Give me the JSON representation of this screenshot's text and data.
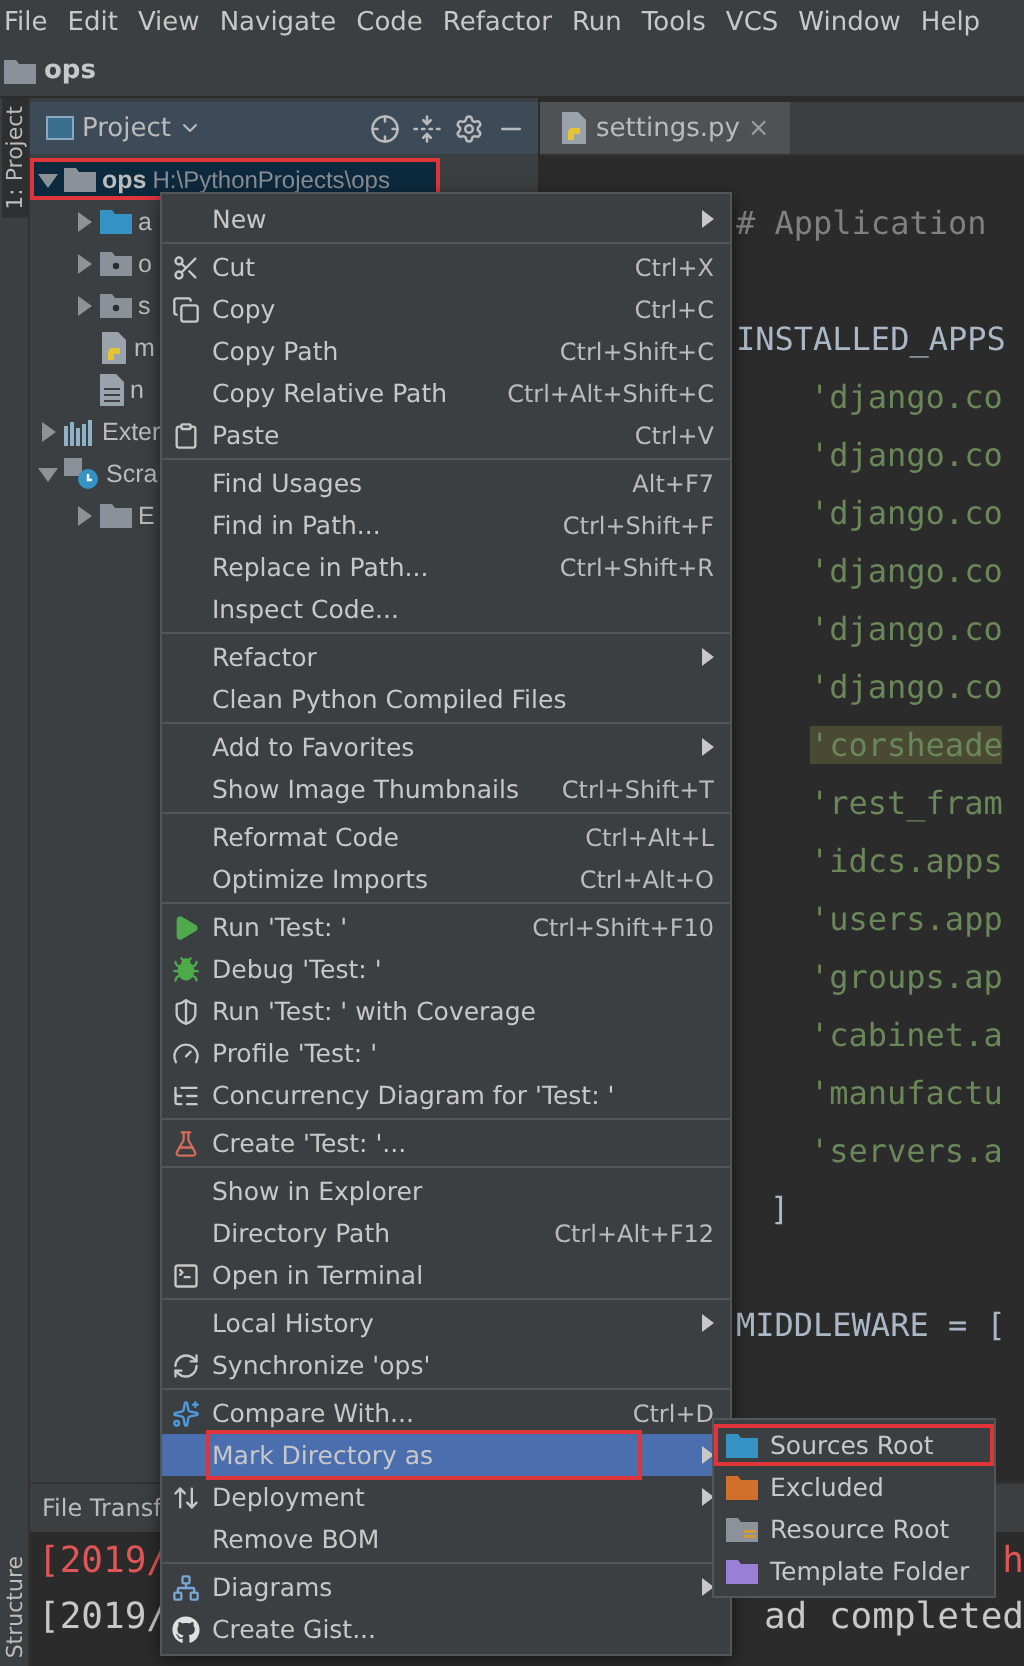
{
  "menu_bar": [
    "File",
    "Edit",
    "View",
    "Navigate",
    "Code",
    "Refactor",
    "Run",
    "Tools",
    "VCS",
    "Window",
    "Help"
  ],
  "nav_bar": {
    "crumb": "ops"
  },
  "side_strip": {
    "top": "1: Project",
    "bottom": "Structure"
  },
  "project_panel": {
    "title": "Project",
    "tree": [
      {
        "label": "ops",
        "path": "H:\\PythonProjects\\ops",
        "kind": "folder",
        "expanded": true,
        "selected": true,
        "annotated": true,
        "children": [
          {
            "label": "a",
            "kind": "source-folder",
            "expanded": false,
            "selected": false
          },
          {
            "label": "o",
            "kind": "package",
            "expanded": false,
            "selected": false
          },
          {
            "label": "s",
            "kind": "package",
            "expanded": false,
            "selected": false
          },
          {
            "label": "m",
            "kind": "python-file",
            "selected": false
          },
          {
            "label": "n",
            "kind": "text-file",
            "selected": false
          }
        ]
      },
      {
        "label": "Exter",
        "kind": "library",
        "expanded": false,
        "selected": false
      },
      {
        "label": "Scra",
        "kind": "scratch",
        "expanded": true,
        "selected": false,
        "children": [
          {
            "label": "E",
            "kind": "folder",
            "expanded": false,
            "selected": false
          }
        ]
      }
    ]
  },
  "editor": {
    "tab": "settings.py",
    "tab_close": "×",
    "lines": [
      {
        "kind": "comment",
        "text": "# Application"
      },
      {
        "kind": "blank"
      },
      {
        "kind": "code",
        "text": "INSTALLED_APPS"
      },
      {
        "kind": "string",
        "text": "'django.co",
        "highlighted": false
      },
      {
        "kind": "string",
        "text": "'django.co",
        "highlighted": false
      },
      {
        "kind": "string",
        "text": "'django.co",
        "highlighted": false
      },
      {
        "kind": "string",
        "text": "'django.co",
        "highlighted": false
      },
      {
        "kind": "string",
        "text": "'django.co",
        "highlighted": false
      },
      {
        "kind": "string",
        "text": "'django.co",
        "highlighted": false
      },
      {
        "kind": "string",
        "text": "'corsheade",
        "highlighted": true
      },
      {
        "kind": "string",
        "text": "'rest_fram",
        "highlighted": false
      },
      {
        "kind": "string",
        "text": "'idcs.apps",
        "highlighted": false
      },
      {
        "kind": "string",
        "text": "'users.app",
        "highlighted": false
      },
      {
        "kind": "string",
        "text": "'groups.ap",
        "highlighted": false
      },
      {
        "kind": "string",
        "text": "'cabinet.a",
        "highlighted": false
      },
      {
        "kind": "string",
        "text": "'manufactu",
        "highlighted": false
      },
      {
        "kind": "string",
        "text": "'servers.a",
        "highlighted": false
      },
      {
        "kind": "bracket",
        "text": "]"
      },
      {
        "kind": "blank"
      },
      {
        "kind": "code",
        "text": "MIDDLEWARE = ["
      }
    ]
  },
  "bottom_panel": {
    "tab": "File Transf",
    "lines": [
      {
        "kind": "error",
        "left": "[2019/",
        "right": "h"
      },
      {
        "kind": "info",
        "left": "[2019/",
        "right": "ad completed"
      }
    ]
  },
  "context_menu": {
    "sections": [
      {
        "items": [
          {
            "label": "New",
            "submenu": true,
            "selected": false
          }
        ]
      },
      {
        "items": [
          {
            "label": "Cut",
            "kind": "cut",
            "shortcut": "Ctrl+X",
            "selected": false
          },
          {
            "label": "Copy",
            "kind": "copy",
            "shortcut": "Ctrl+C",
            "selected": false
          },
          {
            "label": "Copy Path",
            "shortcut": "Ctrl+Shift+C",
            "selected": false
          },
          {
            "label": "Copy Relative Path",
            "shortcut": "Ctrl+Alt+Shift+C",
            "selected": false
          },
          {
            "label": "Paste",
            "kind": "paste",
            "shortcut": "Ctrl+V",
            "selected": false
          }
        ]
      },
      {
        "items": [
          {
            "label": "Find Usages",
            "shortcut": "Alt+F7",
            "selected": false
          },
          {
            "label": "Find in Path...",
            "shortcut": "Ctrl+Shift+F",
            "selected": false
          },
          {
            "label": "Replace in Path...",
            "shortcut": "Ctrl+Shift+R",
            "selected": false
          },
          {
            "label": "Inspect Code...",
            "selected": false
          }
        ]
      },
      {
        "items": [
          {
            "label": "Refactor",
            "submenu": true,
            "selected": false
          },
          {
            "label": "Clean Python Compiled Files",
            "selected": false
          }
        ]
      },
      {
        "items": [
          {
            "label": "Add to Favorites",
            "submenu": true,
            "selected": false
          },
          {
            "label": "Show Image Thumbnails",
            "shortcut": "Ctrl+Shift+T",
            "selected": false
          }
        ]
      },
      {
        "items": [
          {
            "label": "Reformat Code",
            "shortcut": "Ctrl+Alt+L",
            "selected": false
          },
          {
            "label": "Optimize Imports",
            "shortcut": "Ctrl+Alt+O",
            "selected": false
          }
        ]
      },
      {
        "items": [
          {
            "label": "Run 'Test: '",
            "kind": "run",
            "shortcut": "Ctrl+Shift+F10",
            "selected": false
          },
          {
            "label": "Debug 'Test: '",
            "kind": "debug",
            "selected": false
          },
          {
            "label": "Run 'Test: ' with Coverage",
            "kind": "coverage",
            "selected": false
          },
          {
            "label": "Profile 'Test: '",
            "kind": "profile",
            "selected": false
          },
          {
            "label": "Concurrency Diagram for 'Test: '",
            "kind": "concurrency",
            "selected": false
          }
        ]
      },
      {
        "items": [
          {
            "label": "Create 'Test: '...",
            "kind": "create",
            "selected": false
          }
        ]
      },
      {
        "items": [
          {
            "label": "Show in Explorer",
            "selected": false
          },
          {
            "label": "Directory Path",
            "shortcut": "Ctrl+Alt+F12",
            "selected": false
          },
          {
            "label": "Open in Terminal",
            "kind": "terminal",
            "selected": false
          }
        ]
      },
      {
        "items": [
          {
            "label": "Local History",
            "submenu": true,
            "selected": false
          },
          {
            "label": "Synchronize 'ops'",
            "kind": "sync",
            "selected": false
          }
        ]
      },
      {
        "items": [
          {
            "label": "Compare With...",
            "kind": "compare",
            "shortcut": "Ctrl+D",
            "selected": false
          },
          {
            "label": "Mark Directory as",
            "submenu": true,
            "selected": true,
            "annotated": true
          },
          {
            "label": "Deployment",
            "kind": "deploy",
            "submenu": true,
            "selected": false
          },
          {
            "label": "Remove BOM",
            "selected": false
          }
        ]
      },
      {
        "items": [
          {
            "label": "Diagrams",
            "kind": "diagram",
            "submenu": true,
            "selected": false
          },
          {
            "label": "Create Gist...",
            "kind": "gist",
            "selected": false
          }
        ]
      }
    ]
  },
  "submenu": {
    "items": [
      {
        "label": "Sources Root",
        "kind": "folder",
        "color": "#3592c4",
        "selected": false,
        "annotated": true
      },
      {
        "label": "Excluded",
        "kind": "folder",
        "color": "#d0702c",
        "selected": false
      },
      {
        "label": "Resource Root",
        "kind": "resource",
        "color": "#8c9299",
        "selected": false
      },
      {
        "label": "Template Folder",
        "kind": "folder",
        "color": "#9a7fd6",
        "selected": false
      }
    ]
  }
}
